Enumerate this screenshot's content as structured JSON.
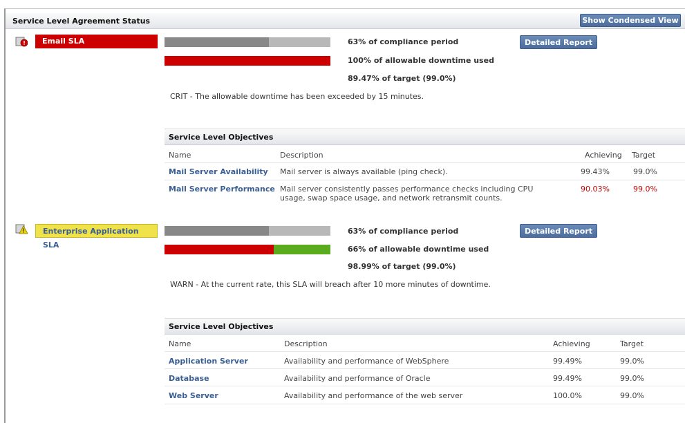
{
  "panel": {
    "title": "Service Level Agreement Status",
    "condensed_button": "Show Condensed View"
  },
  "slas": [
    {
      "name": "Email SLA",
      "status": "critical",
      "icon": "critical-alert-icon",
      "compliance_text": "63% of compliance period",
      "compliance_fraction": 0.63,
      "downtime_text": "100% of allowable downtime used",
      "downtime_fraction": 1.0,
      "target_text": "89.47% of target (99.0%)",
      "report_button": "Detailed Report",
      "message": "CRIT - The allowable downtime has been exceeded by 15 minutes.",
      "slo_title": "Service Level Objectives",
      "columns": {
        "name": "Name",
        "description": "Description",
        "achieving": "Achieving",
        "target": "Target"
      },
      "objectives": [
        {
          "name": "Mail Server Availability",
          "description": "Mail server is always available (ping check).",
          "description2": "",
          "achieving": "99.43%",
          "target": "99.0%",
          "failing": false
        },
        {
          "name": "Mail Server Performance",
          "description": "Mail server consistently passes performance checks including CPU",
          "description2": "usage, swap space usage, and network retransmit counts.",
          "achieving": "90.03%",
          "target": "99.0%",
          "failing": true
        }
      ]
    },
    {
      "name": "Enterprise Application SLA",
      "status": "warning",
      "icon": "warning-alert-icon",
      "compliance_text": "63% of compliance period",
      "compliance_fraction": 0.63,
      "downtime_text": "66% of allowable downtime used",
      "downtime_fraction": 0.66,
      "target_text": "98.99% of target (99.0%)",
      "report_button": "Detailed Report",
      "message": "WARN - At the current rate, this SLA will breach after 10 more minutes of downtime.",
      "slo_title": "Service Level Objectives",
      "columns": {
        "name": "Name",
        "description": "Description",
        "achieving": "Achieving",
        "target": "Target"
      },
      "objectives": [
        {
          "name": "Application Server",
          "description": "Availability and performance of WebSphere",
          "achieving": "99.49%",
          "target": "99.0%",
          "failing": false
        },
        {
          "name": "Database",
          "description": "Availability and performance of Oracle",
          "achieving": "99.49%",
          "target": "99.0%",
          "failing": false
        },
        {
          "name": "Web Server",
          "description": "Availability and performance of the web server",
          "achieving": "100.0%",
          "target": "99.0%",
          "failing": false
        }
      ]
    }
  ],
  "colors": {
    "critical": "#cc0000",
    "warning": "#f0e24a",
    "used_time": "#888888",
    "remaining_time": "#b8b8b8",
    "ok": "#5aab1e",
    "link": "#3a5f95"
  }
}
